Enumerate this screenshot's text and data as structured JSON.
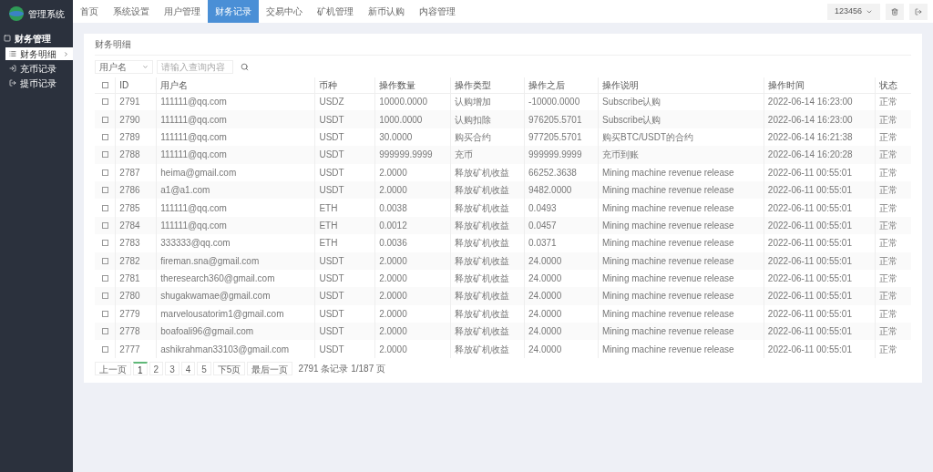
{
  "brand": {
    "title": "管理系统"
  },
  "nav": [
    {
      "label": "首页",
      "selected": false
    },
    {
      "label": "系统设置",
      "selected": false
    },
    {
      "label": "用户管理",
      "selected": false
    },
    {
      "label": "财务记录",
      "selected": true
    },
    {
      "label": "交易中心",
      "selected": false
    },
    {
      "label": "矿机管理",
      "selected": false
    },
    {
      "label": "新币认购",
      "selected": false
    },
    {
      "label": "内容管理",
      "selected": false
    }
  ],
  "user_menu": {
    "label": "123456"
  },
  "sidebar": {
    "group": "财务管理",
    "items": [
      {
        "label": "财务明细",
        "selected": true,
        "kind": "list"
      },
      {
        "label": "充币记录",
        "selected": false,
        "kind": "in"
      },
      {
        "label": "提币记录",
        "selected": false,
        "kind": "out"
      }
    ]
  },
  "panel": {
    "title": "财务明细"
  },
  "search": {
    "field": "用户名",
    "placeholder": "请输入查询内容"
  },
  "table": {
    "all_checked": false,
    "columns": [
      "ID",
      "用户名",
      "币种",
      "操作数量",
      "操作类型",
      "操作之后",
      "操作说明",
      "操作时间",
      "状态"
    ],
    "rows": [
      {
        "checked": false,
        "cells": [
          "2791",
          "111111@qq.com",
          "USDZ",
          "10000.0000",
          "认购增加",
          "-10000.0000",
          "Subscribe认购",
          "2022-06-14 16:23:00",
          "正常"
        ]
      },
      {
        "checked": false,
        "cells": [
          "2790",
          "111111@qq.com",
          "USDT",
          "1000.0000",
          "认购扣除",
          "976205.5701",
          "Subscribe认购",
          "2022-06-14 16:23:00",
          "正常"
        ]
      },
      {
        "checked": false,
        "cells": [
          "2789",
          "111111@qq.com",
          "USDT",
          "30.0000",
          "购买合约",
          "977205.5701",
          "购买BTC/USDT的合约",
          "2022-06-14 16:21:38",
          "正常"
        ]
      },
      {
        "checked": false,
        "cells": [
          "2788",
          "111111@qq.com",
          "USDT",
          "999999.9999",
          "充币",
          "999999.9999",
          "充币到账",
          "2022-06-14 16:20:28",
          "正常"
        ]
      },
      {
        "checked": false,
        "cells": [
          "2787",
          "heima@gmail.com",
          "USDT",
          "2.0000",
          "释放矿机收益",
          "66252.3638",
          "Mining machine revenue release",
          "2022-06-11 00:55:01",
          "正常"
        ]
      },
      {
        "checked": false,
        "cells": [
          "2786",
          "a1@a1.com",
          "USDT",
          "2.0000",
          "释放矿机收益",
          "9482.0000",
          "Mining machine revenue release",
          "2022-06-11 00:55:01",
          "正常"
        ]
      },
      {
        "checked": false,
        "cells": [
          "2785",
          "111111@qq.com",
          "ETH",
          "0.0038",
          "释放矿机收益",
          "0.0493",
          "Mining machine revenue release",
          "2022-06-11 00:55:01",
          "正常"
        ]
      },
      {
        "checked": false,
        "cells": [
          "2784",
          "111111@qq.com",
          "ETH",
          "0.0012",
          "释放矿机收益",
          "0.0457",
          "Mining machine revenue release",
          "2022-06-11 00:55:01",
          "正常"
        ]
      },
      {
        "checked": false,
        "cells": [
          "2783",
          "333333@qq.com",
          "ETH",
          "0.0036",
          "释放矿机收益",
          "0.0371",
          "Mining machine revenue release",
          "2022-06-11 00:55:01",
          "正常"
        ]
      },
      {
        "checked": false,
        "cells": [
          "2782",
          "fireman.sna@gmail.com",
          "USDT",
          "2.0000",
          "释放矿机收益",
          "24.0000",
          "Mining machine revenue release",
          "2022-06-11 00:55:01",
          "正常"
        ]
      },
      {
        "checked": false,
        "cells": [
          "2781",
          "theresearch360@gmail.com",
          "USDT",
          "2.0000",
          "释放矿机收益",
          "24.0000",
          "Mining machine revenue release",
          "2022-06-11 00:55:01",
          "正常"
        ]
      },
      {
        "checked": false,
        "cells": [
          "2780",
          "shugakwamae@gmail.com",
          "USDT",
          "2.0000",
          "释放矿机收益",
          "24.0000",
          "Mining machine revenue release",
          "2022-06-11 00:55:01",
          "正常"
        ]
      },
      {
        "checked": false,
        "cells": [
          "2779",
          "marvelousatorim1@gmail.com",
          "USDT",
          "2.0000",
          "释放矿机收益",
          "24.0000",
          "Mining machine revenue release",
          "2022-06-11 00:55:01",
          "正常"
        ]
      },
      {
        "checked": false,
        "cells": [
          "2778",
          "boafoali96@gmail.com",
          "USDT",
          "2.0000",
          "释放矿机收益",
          "24.0000",
          "Mining machine revenue release",
          "2022-06-11 00:55:01",
          "正常"
        ]
      },
      {
        "checked": false,
        "cells": [
          "2777",
          "ashikrahman33103@gmail.com",
          "USDT",
          "2.0000",
          "释放矿机收益",
          "24.0000",
          "Mining machine revenue release",
          "2022-06-11 00:55:01",
          "正常"
        ]
      }
    ]
  },
  "pagination": {
    "pages": [
      {
        "label": "上一页",
        "selected": false
      },
      {
        "label": "1",
        "selected": true
      },
      {
        "label": "2",
        "selected": false
      },
      {
        "label": "3",
        "selected": false
      },
      {
        "label": "4",
        "selected": false
      },
      {
        "label": "5",
        "selected": false
      },
      {
        "label": "下5页",
        "selected": false
      },
      {
        "label": "最后一页",
        "selected": false
      }
    ],
    "summary": "2791 条记录 1/187 页"
  }
}
